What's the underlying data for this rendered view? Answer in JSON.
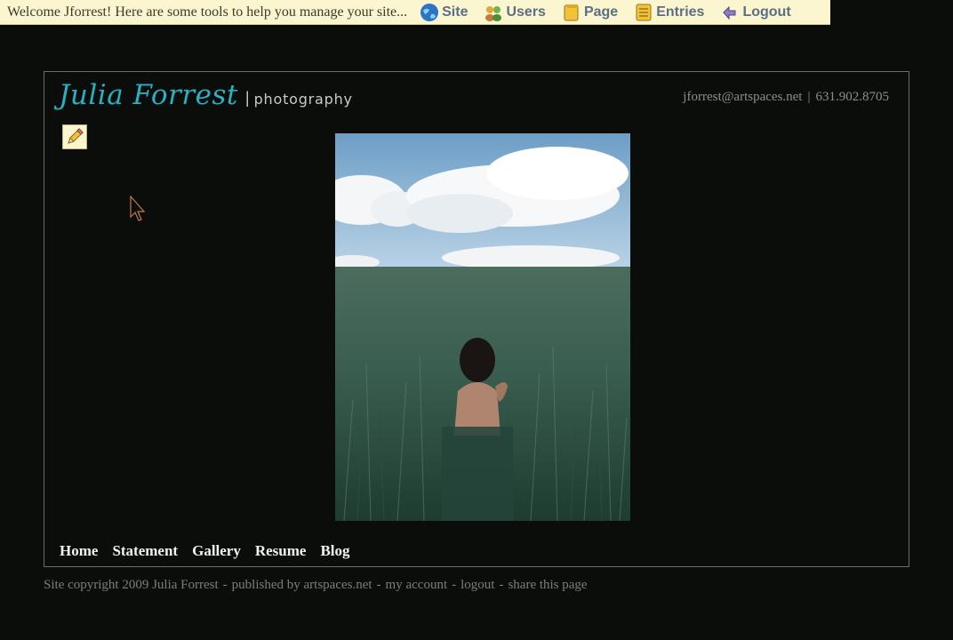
{
  "admin_bar": {
    "welcome": "Welcome Jforrest! Here are some tools to help you manage your site...",
    "links": [
      {
        "label": "Site",
        "icon": "globe-icon"
      },
      {
        "label": "Users",
        "icon": "users-icon"
      },
      {
        "label": "Page",
        "icon": "page-icon"
      },
      {
        "label": "Entries",
        "icon": "entries-icon"
      },
      {
        "label": "Logout",
        "icon": "logout-icon"
      }
    ]
  },
  "header": {
    "brand_name": "Julia Forrest",
    "brand_separator": "|",
    "brand_sub": "photography",
    "email": "jforrest@artspaces.net",
    "contact_separator": "|",
    "phone": "631.902.8705"
  },
  "edit": {
    "icon": "pencil-icon"
  },
  "nav": {
    "items": [
      "Home",
      "Statement",
      "Gallery",
      "Resume",
      "Blog"
    ]
  },
  "footer": {
    "copyright": "Site copyright 2009 Julia Forrest",
    "published_by_prefix": "published by",
    "published_by_link": "artspaces.net",
    "my_account": "my account",
    "logout": "logout",
    "share": "share this page",
    "dash": "-"
  },
  "colors": {
    "background": "#0a0d0a",
    "admin_bar_bg": "#fbf6cf",
    "brand_accent": "#2bb0c2",
    "nav_text": "#f2f2f2",
    "muted_text": "#7b7e7b"
  }
}
